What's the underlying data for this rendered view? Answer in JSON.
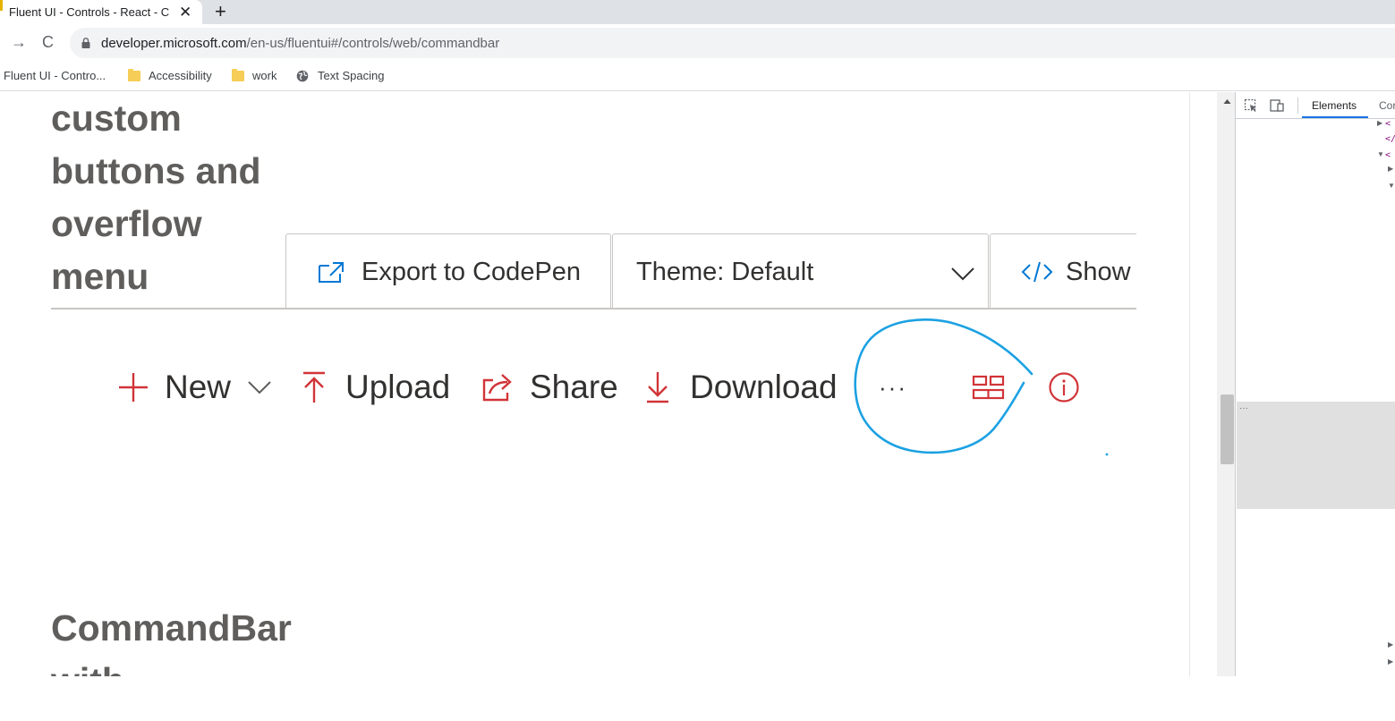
{
  "browser": {
    "tab_title": "Fluent UI - Controls - React - C",
    "tab_close": "✕",
    "new_tab": "+",
    "back": "→",
    "reload": "C",
    "url_host": "developer.microsoft.com",
    "url_path": "/en-us/fluentui#/controls/web/commandbar",
    "bookmarks": [
      {
        "label": "Fluent UI - Contro..."
      },
      {
        "label": "Accessibility"
      },
      {
        "label": "work"
      },
      {
        "label": "Text Spacing"
      }
    ]
  },
  "page": {
    "section_title_lines": [
      "custom",
      "buttons and",
      "overflow",
      "menu"
    ],
    "header_buttons": {
      "export_label": "Export to CodePen",
      "theme_label": "Theme: Default",
      "show_label": "Show"
    },
    "commands": {
      "new_label": "New",
      "upload_label": "Upload",
      "share_label": "Share",
      "download_label": "Download",
      "overflow_label": "···"
    },
    "next_section_lines": [
      "CommandBar",
      "with"
    ]
  },
  "devtools": {
    "elements_tab": "Elements",
    "console_tab": "Cor",
    "dots": "···"
  },
  "colors": {
    "accent_blue": "#0078d4",
    "command_red": "#d13438",
    "annotation_blue": "#1ba1e2",
    "heading_gray": "#605e5c"
  }
}
